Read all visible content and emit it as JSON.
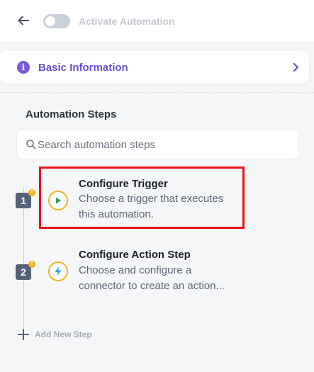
{
  "header": {
    "toggle_label": "Activate Automation",
    "toggle_on": false
  },
  "basic_info": {
    "label": "Basic Information",
    "info_glyph": "i"
  },
  "steps_section": {
    "title": "Automation Steps",
    "search_placeholder": "Search automation steps"
  },
  "steps": [
    {
      "number": "1",
      "title": "Configure Trigger",
      "description": "Choose a trigger that executes this automation.",
      "icon": "play-icon",
      "warning_glyph": "!"
    },
    {
      "number": "2",
      "title": "Configure Action Step",
      "description": "Choose and configure a connector to create an action...",
      "icon": "bolt-icon",
      "warning_glyph": "!"
    }
  ],
  "add_step": {
    "label": "Add New Step"
  },
  "colors": {
    "accent_purple": "#6a4fd0",
    "warning_yellow": "#f3b31d",
    "highlight_red": "#e5141b",
    "step_badge": "#556277"
  }
}
